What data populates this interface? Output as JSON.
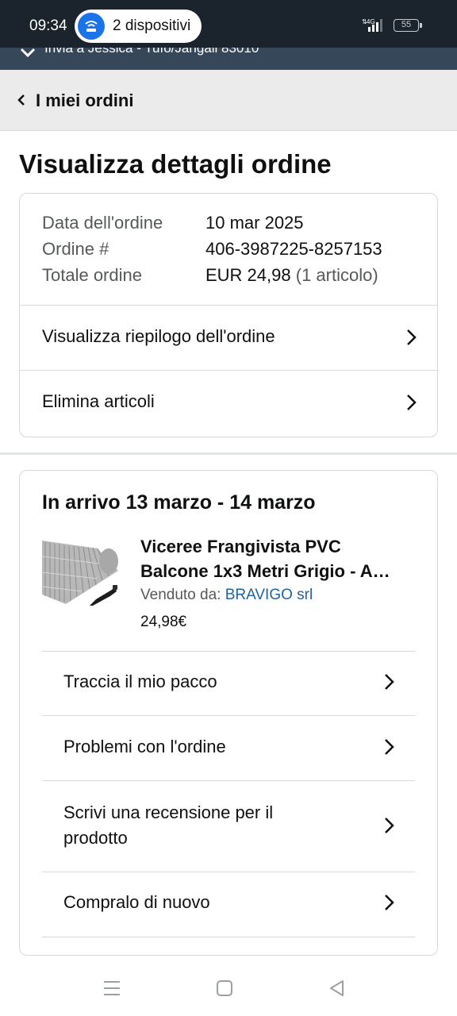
{
  "status_bar": {
    "time": "09:34",
    "cast_label": "2 dispositivi",
    "network": "4G",
    "battery": "55"
  },
  "deliver_strip": {
    "text": "Invia a Jessica - Tufo/Jangali 83010"
  },
  "header": {
    "back_label": "I miei ordini"
  },
  "page": {
    "title": "Visualizza dettagli ordine"
  },
  "order_info": {
    "date_label": "Data dell'ordine",
    "date_value": "10 mar 2025",
    "number_label": "Ordine #",
    "number_value": "406-3987225-8257153",
    "total_label": "Totale ordine",
    "total_value": "EUR 24,98",
    "total_items": "(1 articolo)"
  },
  "order_actions": [
    {
      "label": "Visualizza riepilogo dell'ordine"
    },
    {
      "label": "Elimina articoli"
    }
  ],
  "shipment": {
    "arrival": "In arrivo 13 marzo - 14 marzo",
    "product_title_line1": "Viceree Frangivista PVC",
    "product_title_line2": "Balcone 1x3 Metri Grigio - A…",
    "sold_by_label": "Venduto da:",
    "seller": "BRAVIGO srl",
    "price": "24,98€"
  },
  "shipment_actions": [
    {
      "label": "Traccia il mio pacco"
    },
    {
      "label": "Problemi con l'ordine"
    },
    {
      "label": "Scrivi una recensione per il prodotto"
    },
    {
      "label": "Compralo di nuovo"
    }
  ]
}
